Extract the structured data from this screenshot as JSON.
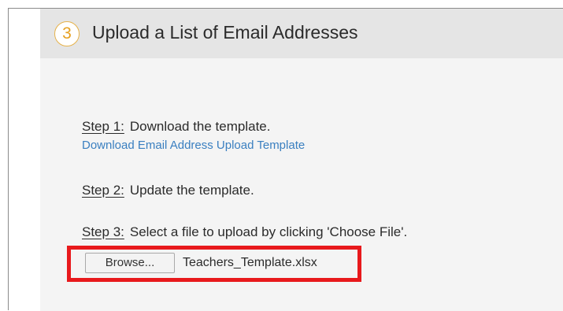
{
  "section": {
    "number": "3",
    "title": "Upload a List of Email Addresses"
  },
  "steps": [
    {
      "label": "Step 1:",
      "text": "Download the template."
    },
    {
      "label": "Step 2:",
      "text": "Update the template."
    },
    {
      "label": "Step 3:",
      "text": "Select a file to upload by clicking 'Choose File'."
    }
  ],
  "download_link": "Download Email Address Upload Template",
  "file_input": {
    "button_label": "Browse...",
    "selected_file": "Teachers_Template.xlsx"
  },
  "colors": {
    "highlight": "#e8191c",
    "link": "#3a7fc0",
    "step_circle_accent": "#e6a020"
  }
}
